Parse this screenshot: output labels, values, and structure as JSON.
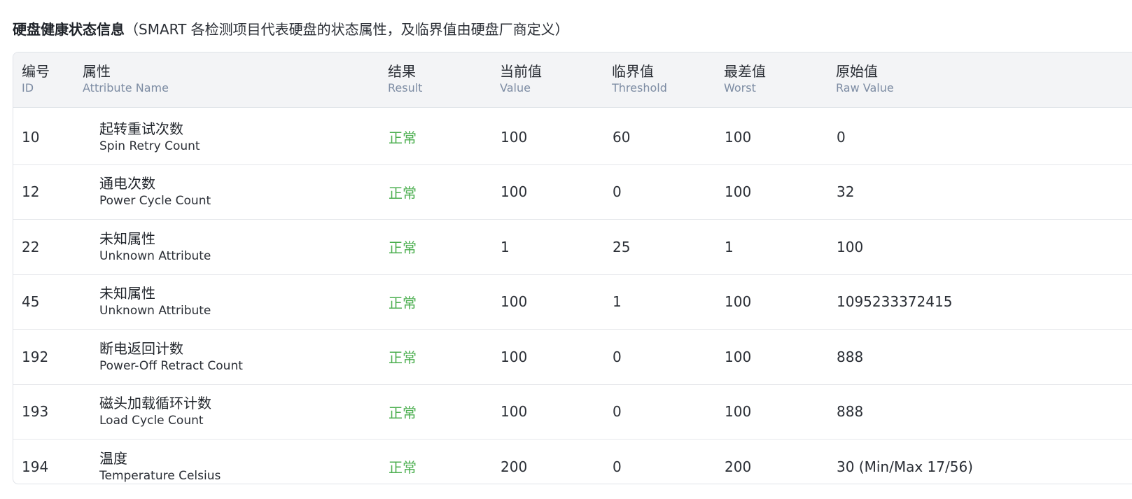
{
  "section": {
    "title_strong": "硬盘健康状态信息",
    "title_note": "（SMART 各检测项目代表硬盘的状态属性，及临界值由硬盘厂商定义）"
  },
  "table": {
    "headers": {
      "id": {
        "zh": "编号",
        "en": "ID"
      },
      "name": {
        "zh": "属性",
        "en": "Attribute Name"
      },
      "result": {
        "zh": "结果",
        "en": "Result"
      },
      "value": {
        "zh": "当前值",
        "en": "Value"
      },
      "threshold": {
        "zh": "临界值",
        "en": "Threshold"
      },
      "worst": {
        "zh": "最差值",
        "en": "Worst"
      },
      "raw": {
        "zh": "原始值",
        "en": "Raw Value"
      }
    },
    "rows": [
      {
        "id": "10",
        "name_zh": "起转重试次数",
        "name_en": "Spin Retry Count",
        "result": "正常",
        "value": "100",
        "threshold": "60",
        "worst": "100",
        "raw": "0"
      },
      {
        "id": "12",
        "name_zh": "通电次数",
        "name_en": "Power Cycle Count",
        "result": "正常",
        "value": "100",
        "threshold": "0",
        "worst": "100",
        "raw": "32"
      },
      {
        "id": "22",
        "name_zh": "未知属性",
        "name_en": "Unknown Attribute",
        "result": "正常",
        "value": "1",
        "threshold": "25",
        "worst": "1",
        "raw": "100"
      },
      {
        "id": "45",
        "name_zh": "未知属性",
        "name_en": "Unknown Attribute",
        "result": "正常",
        "value": "100",
        "threshold": "1",
        "worst": "100",
        "raw": "1095233372415"
      },
      {
        "id": "192",
        "name_zh": "断电返回计数",
        "name_en": "Power-Off Retract Count",
        "result": "正常",
        "value": "100",
        "threshold": "0",
        "worst": "100",
        "raw": "888"
      },
      {
        "id": "193",
        "name_zh": "磁头加载循环计数",
        "name_en": "Load Cycle Count",
        "result": "正常",
        "value": "100",
        "threshold": "0",
        "worst": "100",
        "raw": "888"
      },
      {
        "id": "194",
        "name_zh": "温度",
        "name_en": "Temperature Celsius",
        "result": "正常",
        "value": "200",
        "threshold": "0",
        "worst": "200",
        "raw": "30 (Min/Max 17/56)"
      }
    ]
  },
  "colors": {
    "result_ok": "#4caf50",
    "header_bg": "#f3f4f6",
    "header_sub_text": "#7d8ca3",
    "border": "#dfe3e8"
  }
}
